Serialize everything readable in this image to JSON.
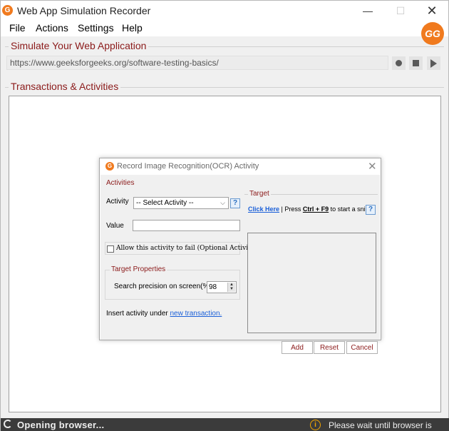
{
  "window": {
    "title": "Web App Simulation Recorder",
    "app_icon_glyph": "G",
    "minimize_glyph": "—",
    "maximize_glyph": "☐",
    "close_glyph": "✕"
  },
  "menu": {
    "items": [
      "File",
      "Actions",
      "Settings",
      "Help"
    ]
  },
  "brand": {
    "logo_glyph": "GG"
  },
  "simulate": {
    "group_title": "Simulate Your Web Application",
    "url": "https://www.geeksforgeeks.org/software-testing-basics/"
  },
  "transactions": {
    "group_title": "Transactions & Activities"
  },
  "dialog": {
    "title": "Record Image Recognition(OCR) Activity",
    "close_glyph": "✕",
    "activities_label": "Activities",
    "activity_label": "Activity",
    "activity_selected": "-- Select Activity --",
    "help_glyph": "?",
    "value_label": "Value",
    "value_text": "",
    "optional_checkbox_label": "Allow this activity to fail (Optional Activity)",
    "target_properties_label": "Target Properties",
    "precision_label": "Search precision on screen(%):",
    "precision_value": "98",
    "insert_prefix": "Insert activity under",
    "insert_link": "new transaction.",
    "target_label": "Target",
    "click_here": "Click Here",
    "snip_middle": " | Press ",
    "shortcut": "Ctrl + F9",
    "snip_suffix": " to start a snip",
    "buttons": {
      "add": "Add",
      "reset": "Reset",
      "cancel": "Cancel"
    }
  },
  "status": {
    "left_text": "Opening browser...",
    "info_glyph": "i",
    "right_text": "Please wait until browser is opened."
  },
  "colors": {
    "accent_orange": "#f07a1e",
    "group_title_red": "#8b1a1a",
    "link_blue": "#1a5fd8",
    "status_bg": "#3b3b3b"
  }
}
